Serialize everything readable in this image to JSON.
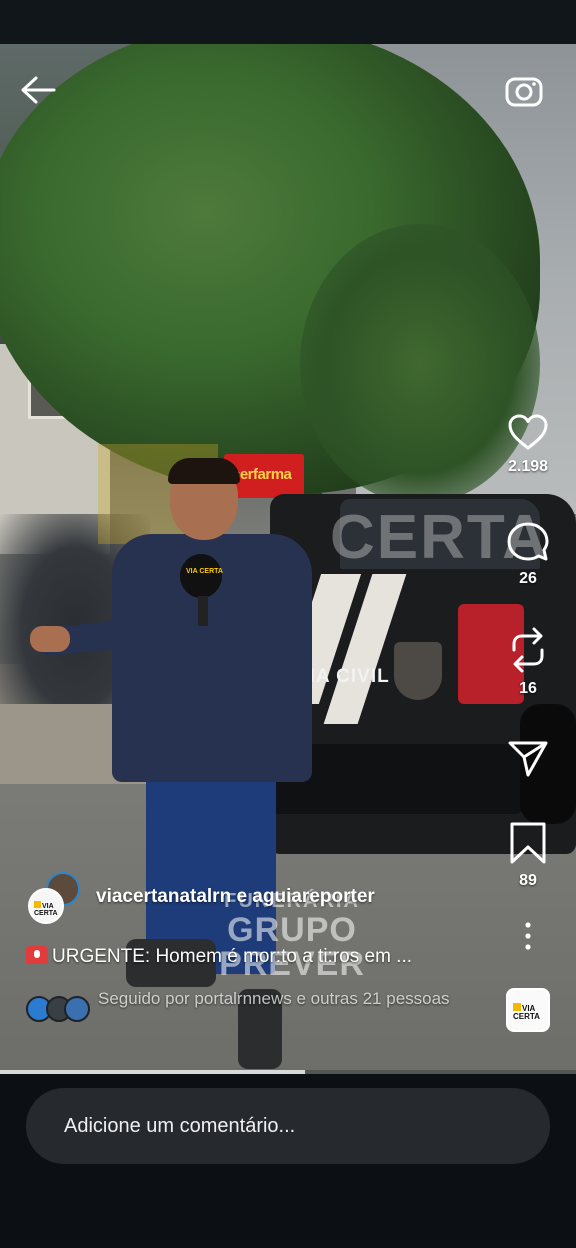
{
  "app": "Instagram Reels",
  "colors": {
    "background": "#0c1014",
    "input_background": "#262a2e",
    "brand_yellow": "#f5b800",
    "alert_red": "#e23b3b"
  },
  "top_bar": {
    "back_icon": "arrow-left-icon",
    "camera_icon": "camera-icon"
  },
  "video": {
    "watermark": "CERTA",
    "sign_text": "serfarma",
    "vehicle_text": "LICIA CIVIL",
    "mic_text": "VIA CERTA",
    "sponsor": {
      "line1": "FUNERÁRIA",
      "line2": "GRUPO",
      "line3": "PREVER"
    },
    "progress": 0.53
  },
  "actions": {
    "like": {
      "icon": "heart-icon",
      "count": "2.198"
    },
    "comment": {
      "icon": "comment-icon",
      "count": "26"
    },
    "repost": {
      "icon": "repost-icon",
      "count": "16"
    },
    "share": {
      "icon": "send-icon"
    },
    "save": {
      "icon": "bookmark-icon",
      "count": "89"
    },
    "more": {
      "icon": "more-vertical-icon"
    }
  },
  "post": {
    "author": "viacertanatalrn e aguiareporter",
    "avatar_logo": "VIA CERTA",
    "caption": "URGENTE: Homem é mor:to a ti:ros em ...",
    "followed_by": "Seguido por portalrnnews e outras 21 pessoas",
    "followed_by_prefix": "Seguido por ",
    "followed_by_user": "portalrnnews",
    "followed_by_suffix": " e outras 21 pessoas",
    "follower_avatars": [
      "RN NEWS",
      "X",
      "G"
    ]
  },
  "audio": {
    "logo": "VIA CERTA"
  },
  "comment_box": {
    "placeholder": "Adicione um comentário..."
  }
}
